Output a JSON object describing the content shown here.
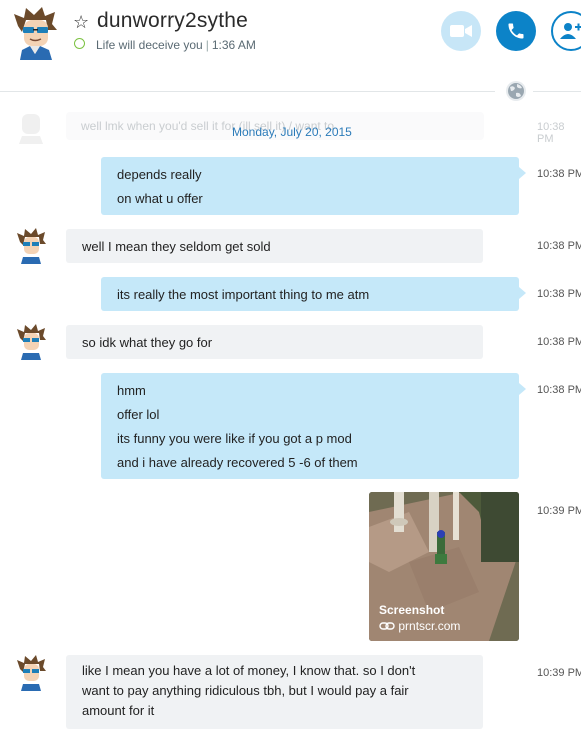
{
  "header": {
    "name": "dunworry2sythe",
    "status": "Life will deceive you",
    "time": "1:36 AM"
  },
  "faded": {
    "text": "well lmk when you'd sell it for (ill sell it) / want to",
    "time": "10:38 PM"
  },
  "date_label": "Monday, July 20, 2015",
  "messages": [
    {
      "lines": [
        "depends really",
        "on what u offer"
      ],
      "time": "10:38 PM"
    },
    {
      "lines": [
        "well I mean they seldom get sold"
      ],
      "time": "10:38 PM"
    },
    {
      "lines": [
        "its really the most important thing to me atm"
      ],
      "time": "10:38 PM"
    },
    {
      "lines": [
        "so idk what they go for"
      ],
      "time": "10:38 PM"
    },
    {
      "lines": [
        "hmm",
        "offer lol",
        "its funny you were like if you got a p mod",
        "and i have already recovered 5 -6 of them"
      ],
      "time": "10:38 PM"
    },
    {
      "time": "10:39 PM"
    },
    {
      "lines": [
        "like I mean you have a lot of money, I know that. so I don't",
        "want to pay anything ridiculous tbh, but I would pay a fair",
        "amount for it"
      ],
      "time": "10:39 PM"
    }
  ],
  "screenshot_card": {
    "title": "Screenshot",
    "source": "prntscr.com"
  },
  "colors": {
    "outgoing_bubble": "#c5e8f9",
    "incoming_bubble": "#f0f2f4",
    "accent": "#0c83c8",
    "presence": "#7cc242"
  },
  "icons": {
    "video": "video-camera-icon",
    "call": "phone-icon",
    "add": "add-person-icon",
    "favorite": "star-icon",
    "globe": "globe-icon",
    "link": "link-icon"
  }
}
